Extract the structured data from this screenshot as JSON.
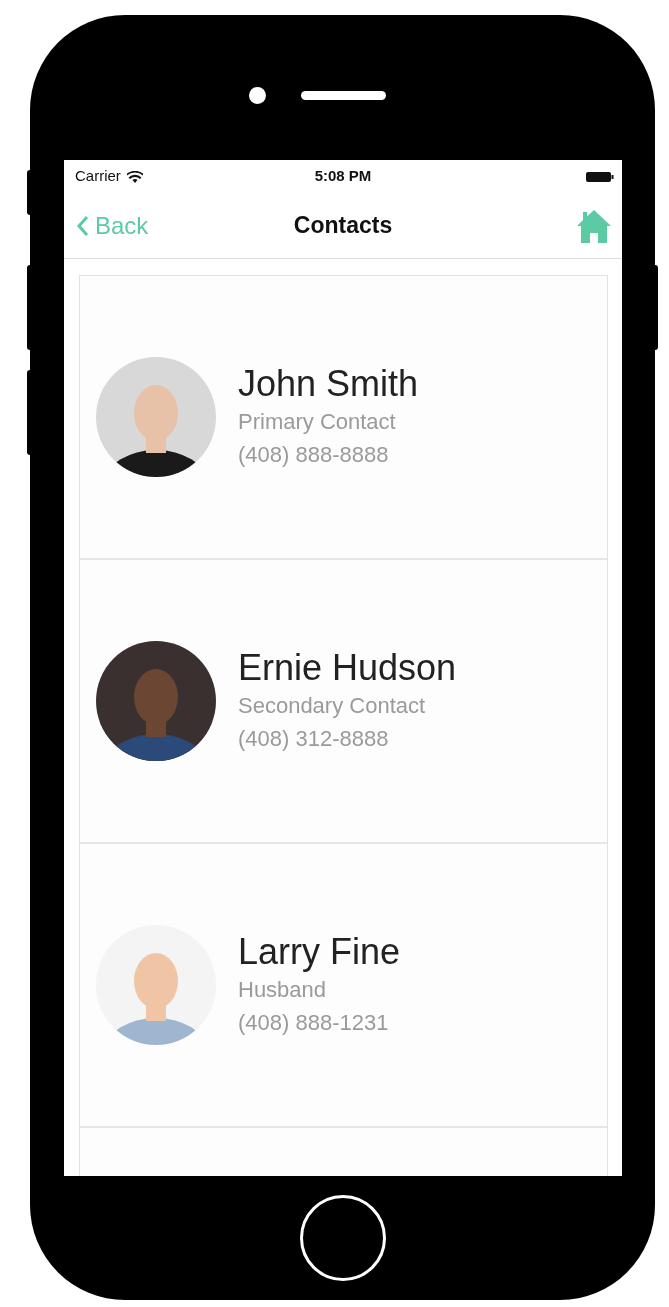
{
  "status_bar": {
    "carrier": "Carrier",
    "time": "5:08 PM"
  },
  "nav": {
    "back_label": "Back",
    "title": "Contacts"
  },
  "contacts": [
    {
      "name": "John Smith",
      "role": "Primary Contact",
      "phone": "(408) 888-8888"
    },
    {
      "name": "Ernie Hudson",
      "role": "Secondary Contact",
      "phone": "(408) 312-8888"
    },
    {
      "name": "Larry Fine",
      "role": "Husband",
      "phone": "(408) 888-1231"
    }
  ]
}
